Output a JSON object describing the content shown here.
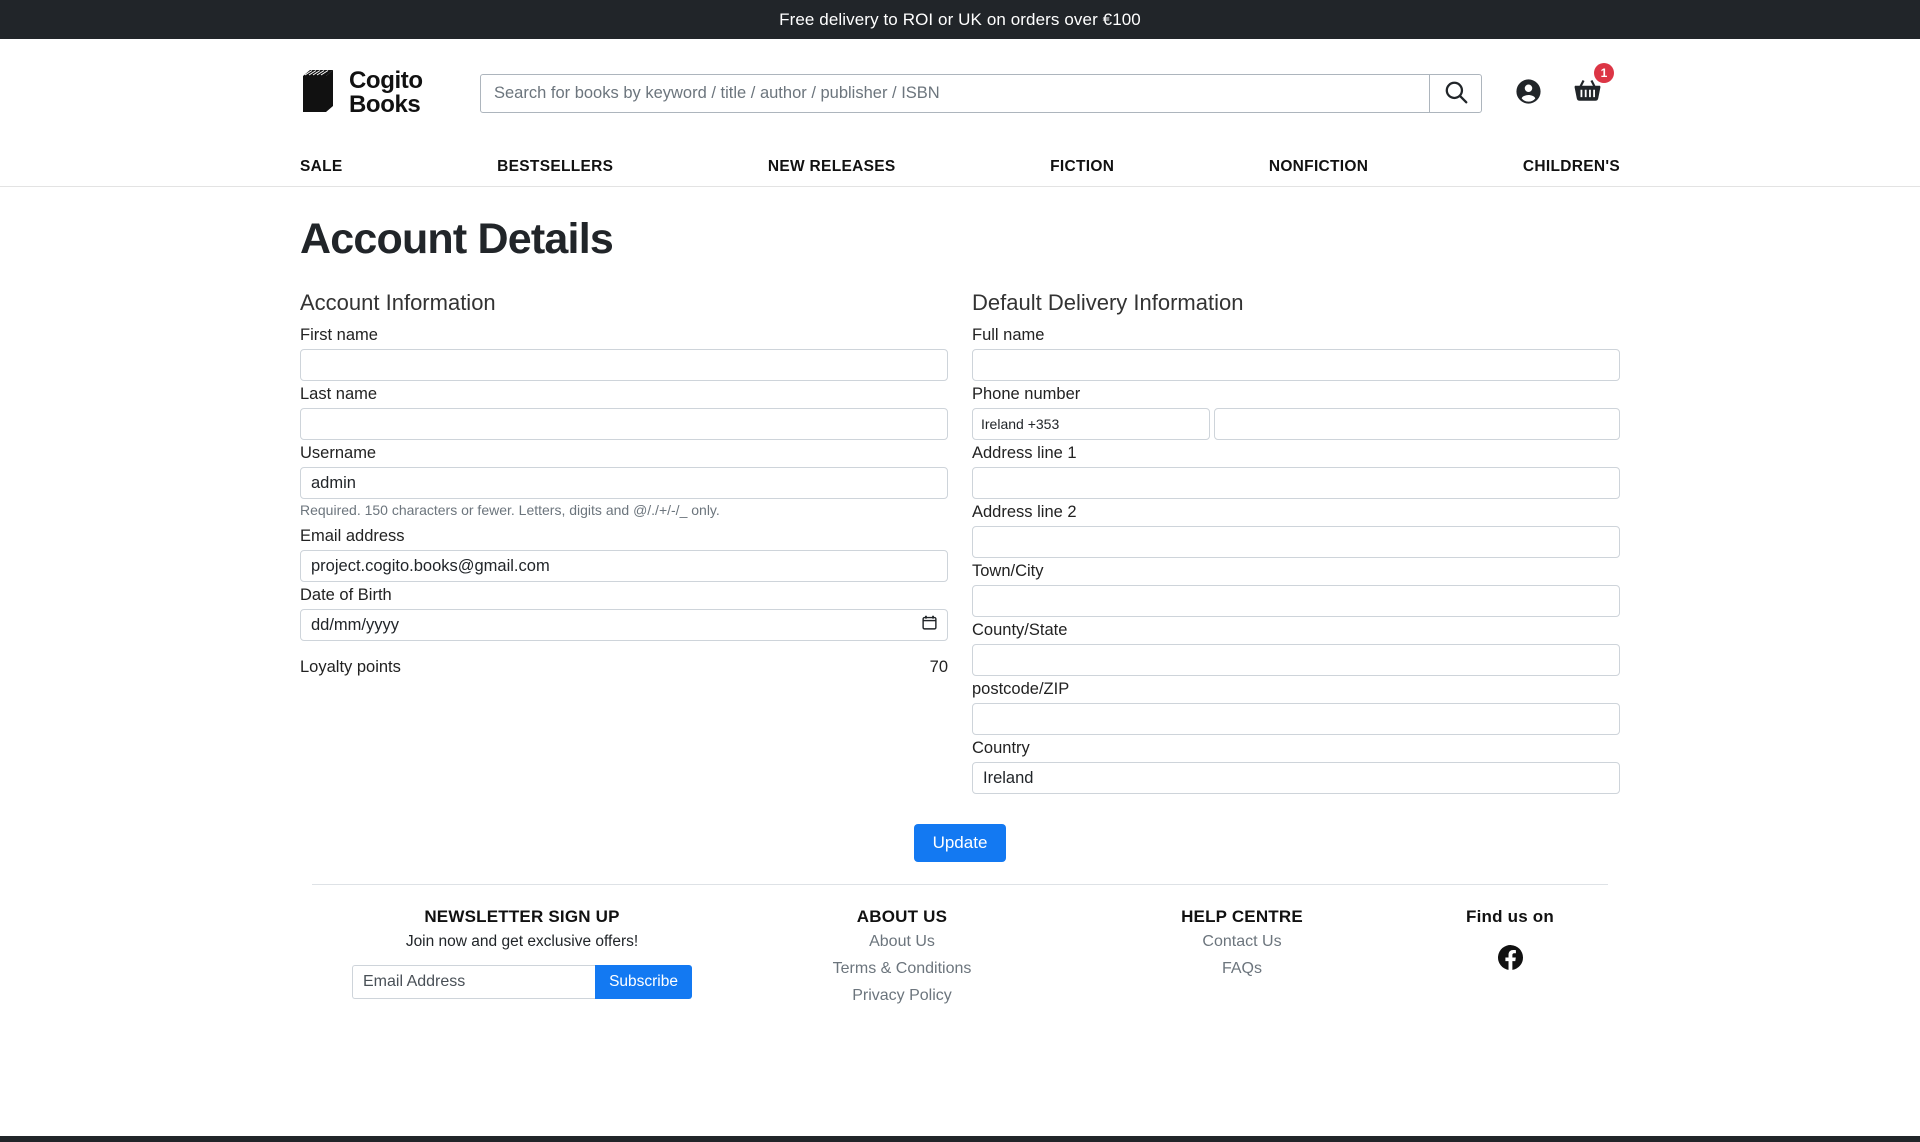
{
  "promo": {
    "text": "Free delivery to ROI or UK on orders over €100"
  },
  "header": {
    "logo_line1": "Cogito",
    "logo_line2": "Books",
    "search_placeholder": "Search for books by keyword / title / author / publisher / ISBN",
    "search_value": "",
    "search_icon": "search-icon",
    "account_icon": "account-circle-icon",
    "cart_icon": "shopping-basket-icon",
    "cart_count": "1"
  },
  "nav": {
    "items": [
      {
        "label": "SALE"
      },
      {
        "label": "BESTSELLERS"
      },
      {
        "label": "NEW RELEASES"
      },
      {
        "label": "FICTION"
      },
      {
        "label": "NONFICTION"
      },
      {
        "label": "CHILDREN'S"
      }
    ]
  },
  "page": {
    "title": "Account Details"
  },
  "account_information": {
    "heading": "Account Information",
    "first_name_label": "First name",
    "first_name_value": "",
    "last_name_label": "Last name",
    "last_name_value": "",
    "username_label": "Username",
    "username_value": "admin",
    "username_help": "Required. 150 characters or fewer. Letters, digits and @/./+/-/_ only.",
    "email_label": "Email address",
    "email_value": "project.cogito.books@gmail.com",
    "dob_label": "Date of Birth",
    "dob_placeholder": "dd/mm/yyyy",
    "dob_value": "",
    "calendar_icon": "calendar-icon",
    "loyalty_label": "Loyalty points",
    "loyalty_value": "70"
  },
  "delivery_information": {
    "heading": "Default Delivery Information",
    "full_name_label": "Full name",
    "full_name_value": "",
    "phone_label": "Phone number",
    "phone_code_value": "Ireland +353",
    "phone_number_value": "",
    "address1_label": "Address line 1",
    "address1_value": "",
    "address2_label": "Address line 2",
    "address2_value": "",
    "town_label": "Town/City",
    "town_value": "",
    "county_label": "County/State",
    "county_value": "",
    "postcode_label": "postcode/ZIP",
    "postcode_value": "",
    "country_label": "Country",
    "country_value": "Ireland"
  },
  "actions": {
    "update_label": "Update"
  },
  "footer": {
    "newsletter": {
      "heading": "NEWSLETTER SIGN UP",
      "subtext": "Join now and get exclusive offers!",
      "email_placeholder": "Email Address",
      "email_value": "",
      "subscribe_label": "Subscribe"
    },
    "about": {
      "heading": "ABOUT US",
      "links": [
        {
          "label": "About Us"
        },
        {
          "label": "Terms & Conditions"
        },
        {
          "label": "Privacy Policy"
        }
      ]
    },
    "help": {
      "heading": "HELP CENTRE",
      "links": [
        {
          "label": "Contact Us"
        },
        {
          "label": "FAQs"
        }
      ]
    },
    "social": {
      "heading": "Find us on",
      "facebook_icon": "facebook-icon"
    }
  },
  "colors": {
    "accent_blue": "#1379f2",
    "badge_red": "#dc3545",
    "dark": "#212529"
  }
}
